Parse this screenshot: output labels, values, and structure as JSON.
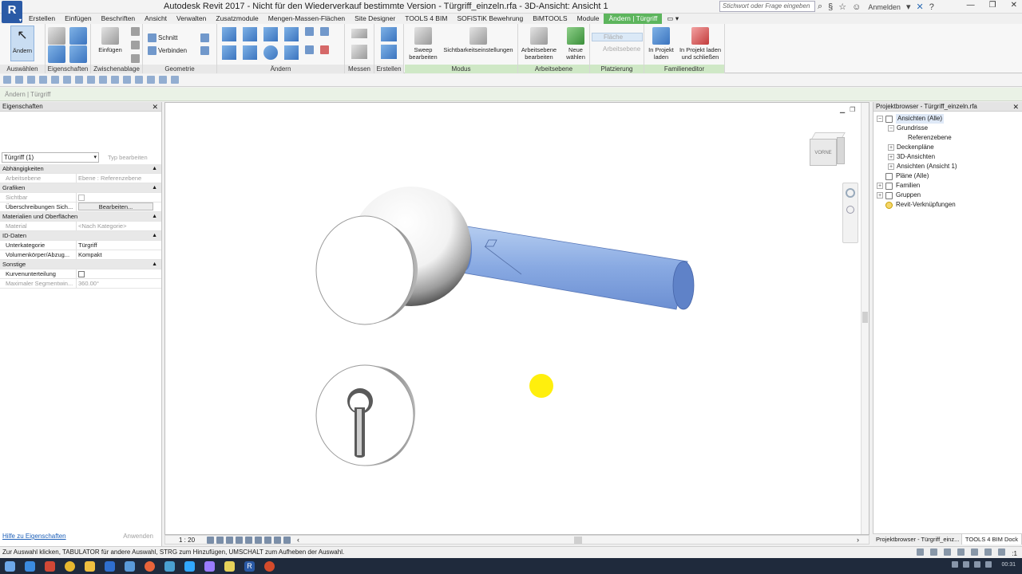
{
  "window": {
    "title": "Autodesk Revit 2017 - Nicht für den Wiederverkauf bestimmte Version -     Türgriff_einzeln.rfa - 3D-Ansicht: Ansicht 1",
    "search_placeholder": "Stichwort oder Frage eingeben",
    "login_label": "Anmelden",
    "app_letter": "R"
  },
  "tabs": [
    {
      "label": "Erstellen"
    },
    {
      "label": "Einfügen"
    },
    {
      "label": "Beschriften"
    },
    {
      "label": "Ansicht"
    },
    {
      "label": "Verwalten"
    },
    {
      "label": "Zusatzmodule"
    },
    {
      "label": "Mengen-Massen-Flächen"
    },
    {
      "label": "Site Designer"
    },
    {
      "label": "TOOLS 4 BIM"
    },
    {
      "label": "SOFiSTiK Bewehrung"
    },
    {
      "label": "BiMTOOLS"
    },
    {
      "label": "Module"
    },
    {
      "label": "Ändern | Türgriff"
    }
  ],
  "ribbon": {
    "modify_label": "Ändern",
    "paste_label": "Einfügen",
    "cut_label": "Schnitt",
    "join_label": "Verbinden",
    "sweep_label": "Sweep bearbeiten",
    "visibility_label": "Sichtbarkeitseinstellungen",
    "workplane_edit_label": "Arbeitsebene bearbeiten",
    "new_select_label": "Neue wählen",
    "face_label": "Fläche",
    "workplane_label": "Arbeitsebene",
    "load_label": "In Projekt laden",
    "load_close_label": "In Projekt laden und schließen",
    "panels": {
      "select": "Auswählen",
      "properties": "Eigenschaften",
      "clipboard": "Zwischenablage",
      "geometry": "Geometrie",
      "modify": "Ändern",
      "measure": "Messen",
      "create": "Erstellen",
      "mode": "Modus",
      "workplane": "Arbeitsebene",
      "placement": "Platzierung",
      "family_editor": "Familieneditor"
    }
  },
  "options_bar": "Ändern | Türgriff",
  "properties": {
    "title": "Eigenschaften",
    "type_selector": "Türgriff (1)",
    "edit_type": "Typ bearbeiten",
    "groups": {
      "constraints": "Abhängigkeiten",
      "graphics": "Grafiken",
      "materials": "Materialien und Oberflächen",
      "id": "ID-Daten",
      "other": "Sonstige"
    },
    "rows": {
      "workplane_k": "Arbeitsebene",
      "workplane_v": "Ebene : Referenzebene",
      "visible_k": "Sichtbar",
      "override_k": "Überschreibungen Sich...",
      "override_btn": "Bearbeiten...",
      "material_k": "Material",
      "material_v": "<Nach Kategorie>",
      "subcat_k": "Unterkategorie",
      "subcat_v": "Türgriff",
      "solid_k": "Volumenkörper/Abzug...",
      "solid_v": "Kompakt",
      "curve_k": "Kurvenunterteilung",
      "segment_k": "Maximaler Segmentwin...",
      "segment_v": "360.00°"
    },
    "help_link": "Hilfe zu Eigenschaften",
    "apply": "Anwenden"
  },
  "viewport": {
    "viewcube_label": "VORNE",
    "scale": "1 : 20"
  },
  "browser": {
    "title": "Projektbrowser - Türgriff_einzeln.rfa",
    "items": [
      {
        "label": "Ansichten (Alle)",
        "exp": "−"
      },
      {
        "label": "Grundrisse",
        "exp": "−"
      },
      {
        "label": "Referenzebene",
        "exp": ""
      },
      {
        "label": "Deckenpläne",
        "exp": "+"
      },
      {
        "label": "3D-Ansichten",
        "exp": "+"
      },
      {
        "label": "Ansichten (Ansicht 1)",
        "exp": "+"
      },
      {
        "label": "Pläne (Alle)",
        "exp": ""
      },
      {
        "label": "Familien",
        "exp": "+"
      },
      {
        "label": "Gruppen",
        "exp": "+"
      },
      {
        "label": "Revit-Verknüpfungen",
        "exp": ""
      }
    ],
    "footer_tabs": [
      "Projektbrowser - Türgriff_einz...",
      "TOOLS 4 BIM Dock"
    ]
  },
  "status": {
    "text": "Zur Auswahl klicken, TABULATOR für andere Auswahl, STRG zum Hinzufügen, UMSCHALT zum Aufheben der Auswahl.",
    "selection_count": ":1"
  },
  "taskbar": {
    "clock": "00:31"
  },
  "colors": {
    "context_tab": "#5db55d",
    "handle_blue": "#6f9bde",
    "cursor_highlight": "#ffee00"
  }
}
